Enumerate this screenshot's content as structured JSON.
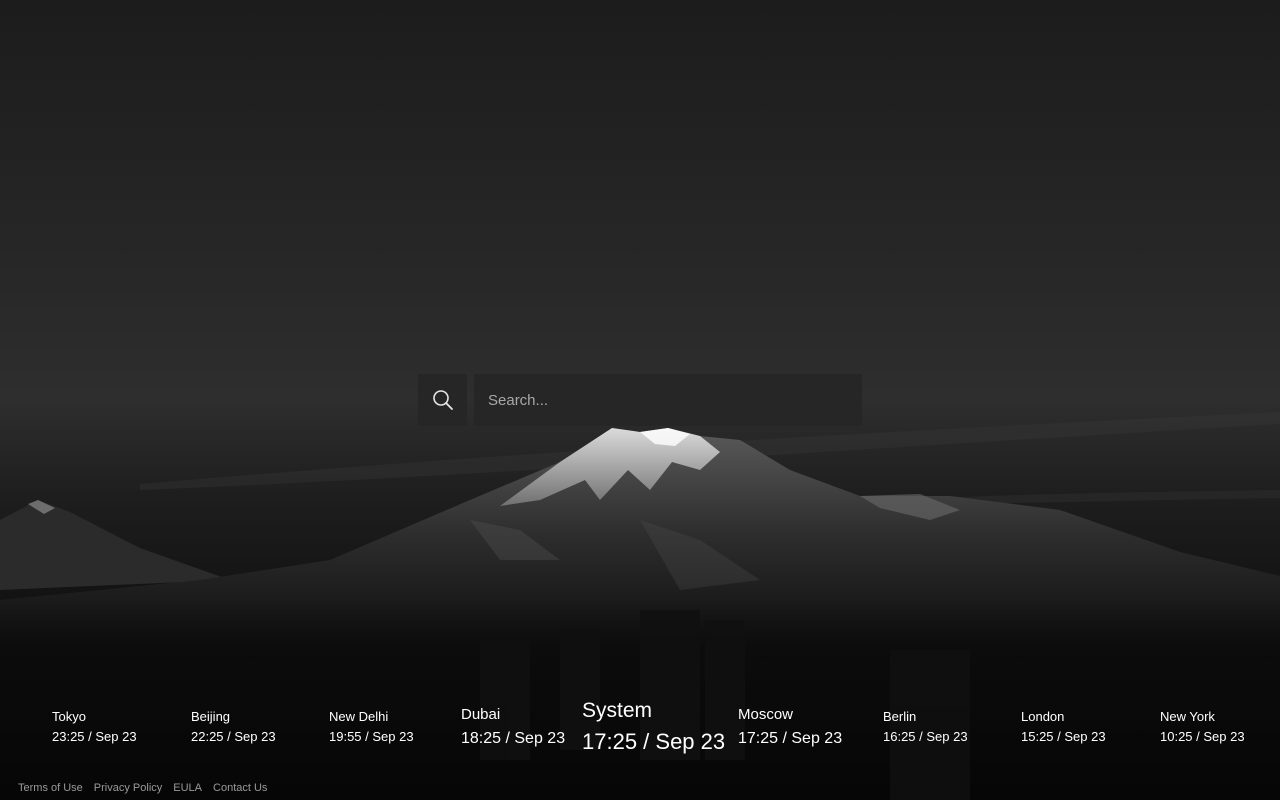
{
  "search": {
    "placeholder": "Search..."
  },
  "icons": {
    "search": "search-icon"
  },
  "clocks": [
    {
      "city": "Tokyo",
      "time": "23:25 / Sep 23"
    },
    {
      "city": "Beijing",
      "time": "22:25 / Sep 23"
    },
    {
      "city": "New Delhi",
      "time": "19:55 / Sep 23"
    },
    {
      "city": "Dubai",
      "time": "18:25 / Sep 23"
    },
    {
      "city": "System",
      "time": "17:25 / Sep 23"
    },
    {
      "city": "Moscow",
      "time": "17:25 / Sep 23"
    },
    {
      "city": "Berlin",
      "time": "16:25 / Sep 23"
    },
    {
      "city": "London",
      "time": "15:25 / Sep 23"
    },
    {
      "city": "New York",
      "time": "10:25 / Sep 23"
    }
  ],
  "footer": {
    "terms": "Terms of Use",
    "privacy": "Privacy Policy",
    "eula": "EULA",
    "contact": "Contact Us"
  }
}
